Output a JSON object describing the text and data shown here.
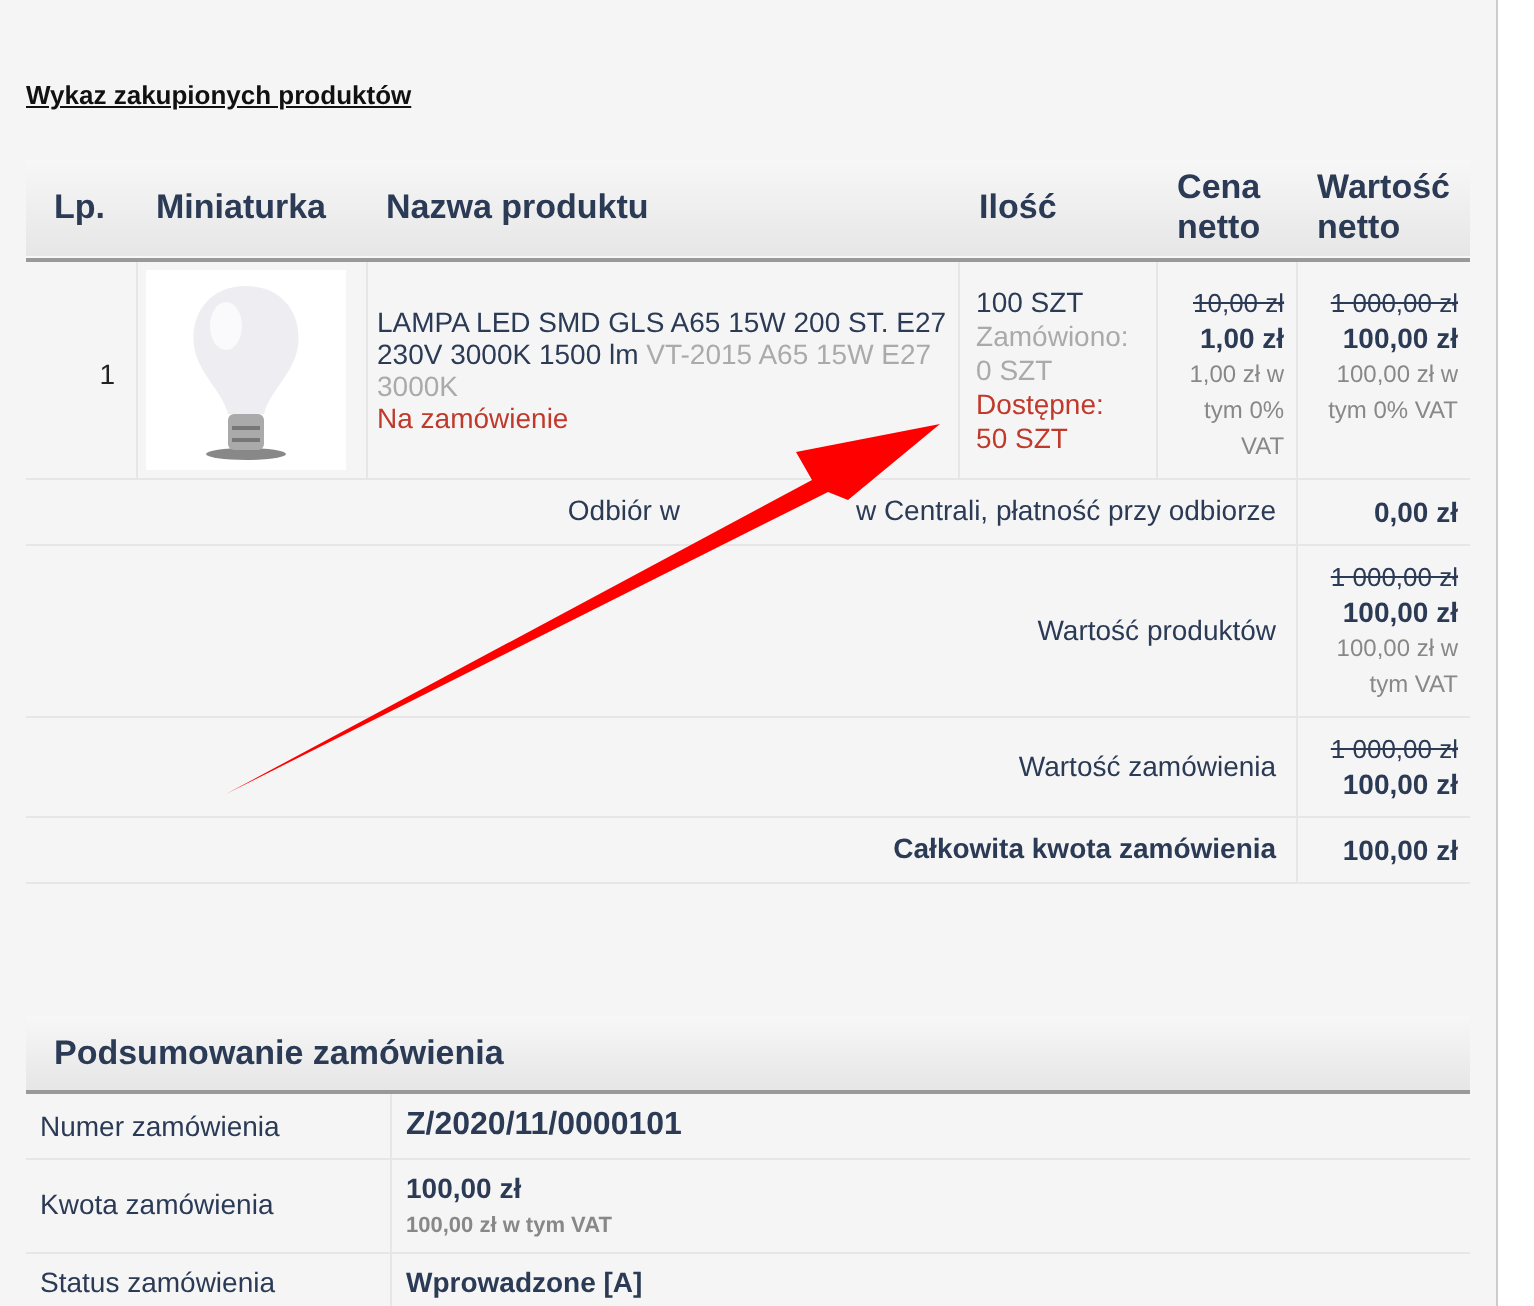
{
  "section_title": "Wykaz zakupionych produktów",
  "table": {
    "columns": [
      "Lp.",
      "Miniaturka",
      "Nazwa produktu",
      "Ilość",
      "Cena netto",
      "Wartość netto"
    ],
    "rows": [
      {
        "lp": "1",
        "name": "LAMPA LED SMD GLS A65 15W 200 ST. E27 230V 3000K 1500 lm",
        "code": "VT-2015 A65 15W E27 3000K",
        "availability": "Na zamówienie",
        "quantity": "100 SZT",
        "ordered": "Zamówiono: 0 SZT",
        "available": "Dostępne: 50 SZT",
        "price_old": "10,00 zł",
        "price": "1,00 zł",
        "price_vat": "1,00 zł w tym 0% VAT",
        "value_old": "1 000,00 zł",
        "value": "100,00 zł",
        "value_vat": "100,00 zł w tym 0% VAT"
      }
    ],
    "summary": [
      {
        "label_parts": [
          "Odbiór w",
          "w Centrali, płatność przy odbiorze"
        ],
        "bold": false,
        "value": "0,00 zł"
      },
      {
        "label": "Wartość produktów",
        "bold": false,
        "old": "1 000,00 zł",
        "value": "100,00 zł",
        "vat": "100,00 zł w tym VAT"
      },
      {
        "label": "Wartość zamówienia",
        "bold": false,
        "old": "1 000,00 zł",
        "value": "100,00 zł"
      },
      {
        "label": "Całkowita kwota zamówienia",
        "bold": true,
        "value": "100,00 zł"
      }
    ]
  },
  "order_summary": {
    "title": "Podsumowanie zamówienia",
    "rows": [
      {
        "label": "Numer zamówienia",
        "value": "Z/2020/11/0000101",
        "kind": "large",
        "note": null
      },
      {
        "label": "Kwota zamówienia",
        "value": "100,00 zł",
        "kind": "normal",
        "note": "100,00 zł w tym VAT"
      },
      {
        "label": "Status zamówienia",
        "value": "Wprowadzone [A]",
        "kind": "normal",
        "note": null
      }
    ]
  }
}
